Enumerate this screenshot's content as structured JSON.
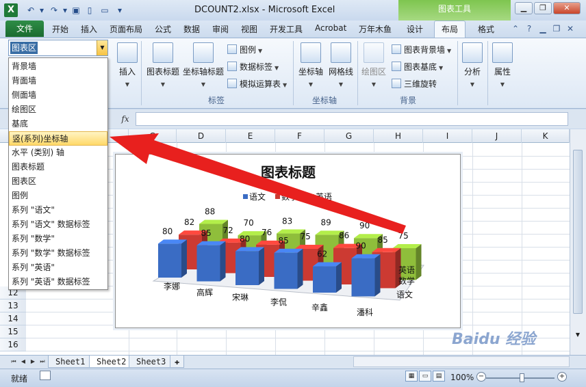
{
  "window": {
    "title": "DCOUNT2.xlsx - Microsoft Excel",
    "app_icon": "X",
    "quick_access": [
      "save-icon",
      "undo-icon",
      "redo-icon",
      "new-icon",
      "open-icon",
      "customize-icon"
    ]
  },
  "context_tab": "图表工具",
  "tabs": [
    "文件",
    "开始",
    "插入",
    "页面布局",
    "公式",
    "数据",
    "审阅",
    "视图",
    "开发工具",
    "Acrobat",
    "万年木鱼",
    "设计",
    "布局",
    "格式"
  ],
  "active_tab": "布局",
  "selection": {
    "current": "图表区",
    "items": [
      "背景墙",
      "背面墙",
      "侧面墙",
      "绘图区",
      "基底",
      "竖(系列)坐标轴",
      "水平 (类别) 轴",
      "图表标题",
      "图表区",
      "图例",
      "系列 \"语文\"",
      "系列 \"语文\" 数据标签",
      "系列 \"数学\"",
      "系列 \"数学\" 数据标签",
      "系列 \"英语\"",
      "系列 \"英语\" 数据标签"
    ],
    "highlighted_index": 5
  },
  "ribbon": {
    "insert": "插入",
    "chart_title": "图表标题",
    "axis_title": "坐标轴标题",
    "legend": "图例",
    "data_labels": "数据标签",
    "data_table": "模拟运算表",
    "labels_group": "标签",
    "axes": "坐标轴",
    "gridlines": "网格线",
    "axes_group": "坐标轴",
    "plot_area": "绘图区",
    "chart_wall": "图表背景墙",
    "chart_floor": "图表基底",
    "rotation_3d": "三维旋转",
    "background_group": "背景",
    "analysis": "分析",
    "properties": "属性"
  },
  "formula_bar": {
    "fx": "fx",
    "value": ""
  },
  "columns": [
    "C",
    "D",
    "E",
    "F",
    "G",
    "H",
    "I",
    "J",
    "K"
  ],
  "rows": [
    "12",
    "13",
    "14",
    "15",
    "16"
  ],
  "chart_data": {
    "type": "bar",
    "title": "图表标题",
    "categories": [
      "李娜",
      "高辉",
      "宋琳",
      "李侃",
      "辛鑫",
      "潘科"
    ],
    "series": [
      {
        "name": "语文",
        "values": [
          80,
          85,
          80,
          85,
          62,
          90
        ],
        "color": "#3a6cc4"
      },
      {
        "name": "数学",
        "values": [
          82,
          72,
          76,
          75,
          86,
          85
        ],
        "color": "#cc3a32"
      },
      {
        "name": "英语",
        "values": [
          88,
          70,
          83,
          89,
          90,
          75
        ],
        "color": "#8fbe3b"
      }
    ],
    "depth_labels": [
      "英语",
      "数学",
      "语文"
    ],
    "legend_position": "top"
  },
  "sheets": [
    "Sheet1",
    "Sheet2",
    "Sheet3"
  ],
  "active_sheet": "Sheet2",
  "status": {
    "ready": "就绪",
    "zoom": "100%"
  },
  "watermark": "Baidu 经验"
}
